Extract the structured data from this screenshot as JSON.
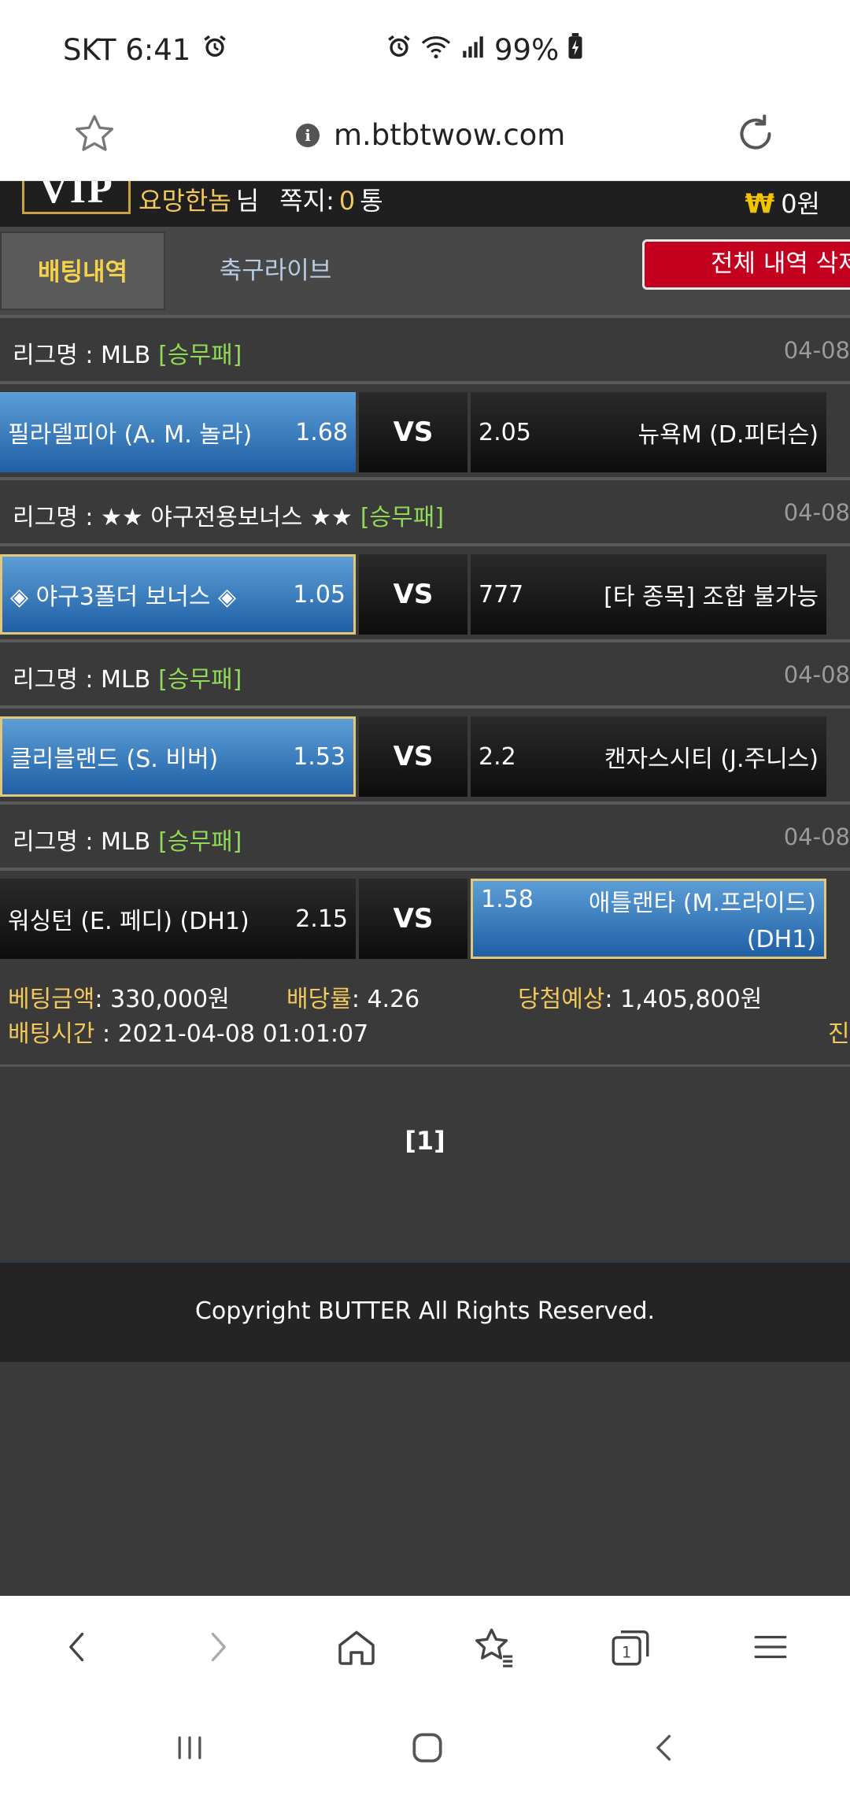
{
  "status_bar": {
    "carrier_time": "SKT 6:41",
    "battery": "99%"
  },
  "url_bar": {
    "url": "m.btbtwow.com"
  },
  "header": {
    "vip_badge": "VIP",
    "username": "요망한놈",
    "honorific": "님",
    "message_label": "쪽지:",
    "message_count": "0",
    "message_unit": "통",
    "balance": "0원"
  },
  "tabs": {
    "active": "배팅내역",
    "inactive": "축구라이브",
    "delete_all": "전체 내역 삭제"
  },
  "bets": [
    {
      "league_prefix": "리그명 : MLB",
      "bet_type": "[승무패]",
      "date": "04-08",
      "home_name": "필라델피아 (A. M. 놀라)",
      "home_odds": "1.68",
      "vs": "VS",
      "away_odds": "2.05",
      "away_name": "뉴욕M (D.피터슨)"
    },
    {
      "league_prefix": "리그명 : ★★ 야구전용보너스 ★★",
      "bet_type": "[승무패]",
      "date": "04-08",
      "home_name": "◈ 야구3폴더 보너스 ◈",
      "home_odds": "1.05",
      "vs": "VS",
      "away_odds": "777",
      "away_name": "[타 종목] 조합 불가능"
    },
    {
      "league_prefix": "리그명 : MLB",
      "bet_type": "[승무패]",
      "date": "04-08",
      "home_name": "클리블랜드 (S. 비버)",
      "home_odds": "1.53",
      "vs": "VS",
      "away_odds": "2.2",
      "away_name": "캔자스시티 (J.주니스)"
    },
    {
      "league_prefix": "리그명 : MLB",
      "bet_type": "[승무패]",
      "date": "04-08",
      "home_name": "워싱턴 (E. 페디) (DH1)",
      "home_odds": "2.15",
      "vs": "VS",
      "away_odds": "1.58",
      "away_name": "애틀랜타 (M.프라이드) (DH1)"
    }
  ],
  "summary": {
    "bet_amount_label": "베팅금액",
    "bet_amount": ": 330,000원",
    "odds_label": "배당률",
    "odds": ": 4.26",
    "expected_label": "당첨예상",
    "expected": ": 1,405,800원",
    "time_label": "배팅시간",
    "time": " : 2021-04-08 01:01:07",
    "status_partial": "진"
  },
  "pagination": "[1]",
  "footer": "Copyright BUTTER All Rights Reserved."
}
